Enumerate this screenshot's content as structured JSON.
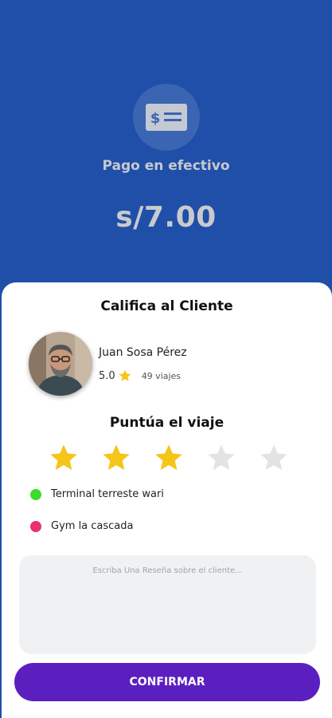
{
  "payment": {
    "icon": "cash-icon",
    "method_label": "Pago en efectivo",
    "amount": "s/7.00"
  },
  "rating_card": {
    "title": "Califica al Cliente",
    "client": {
      "name": "Juan Sosa Pérez",
      "rating": "5.0",
      "trips": "49 viajes"
    },
    "trip_rating": {
      "title": "Puntúa el viaje",
      "value": 3,
      "max": 5,
      "active_color": "#f5c518",
      "inactive_color": "#e3e3e3"
    },
    "route": {
      "origin": {
        "label": "Terminal terreste wari",
        "color": "#3ddc2b"
      },
      "destination": {
        "label": "Gym la cascada",
        "color": "#e8316f"
      }
    },
    "review": {
      "placeholder": "Escriba Una Reseña sobre el cliente...",
      "value": ""
    },
    "confirm_label": "CONFIRMAR"
  },
  "colors": {
    "header_bg": "#1f4fa8",
    "confirm_bg": "#5c1fbf"
  }
}
